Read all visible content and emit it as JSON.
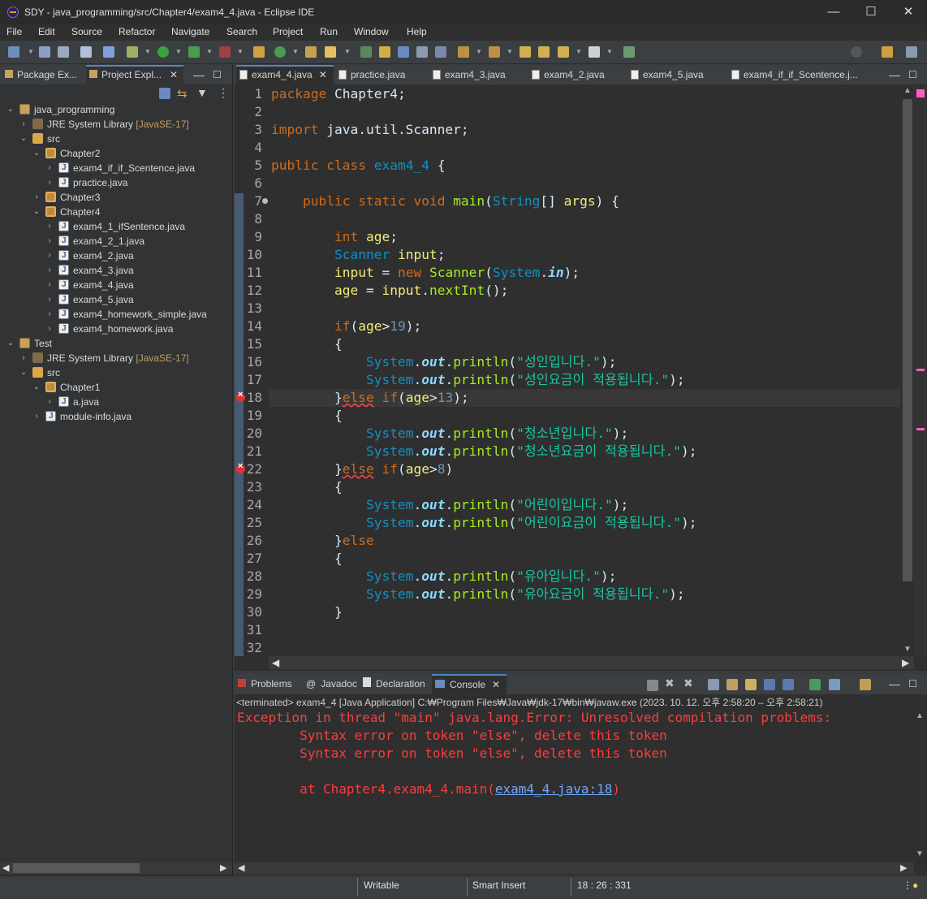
{
  "window": {
    "title": "SDY - java_programming/src/Chapter4/exam4_4.java - Eclipse IDE",
    "minimize": "—",
    "maximize": "☐",
    "close": "✕"
  },
  "menu": [
    "File",
    "Edit",
    "Source",
    "Refactor",
    "Navigate",
    "Search",
    "Project",
    "Run",
    "Window",
    "Help"
  ],
  "left_tabs": {
    "package_explorer": "Package Ex...",
    "project_explorer": "Project Expl..."
  },
  "tree": [
    {
      "label": "java_programming",
      "level": 0,
      "icon": "project",
      "expanded": true
    },
    {
      "label": "JRE System Library",
      "decor": "[JavaSE-17]",
      "level": 1,
      "icon": "library",
      "expanded": false
    },
    {
      "label": "src",
      "level": 1,
      "icon": "source-folder",
      "expanded": true
    },
    {
      "label": "Chapter2",
      "level": 2,
      "icon": "package",
      "expanded": true
    },
    {
      "label": "exam4_if_if_Scentence.java",
      "level": 3,
      "icon": "java-file",
      "expanded": false
    },
    {
      "label": "practice.java",
      "level": 3,
      "icon": "java-file",
      "expanded": false
    },
    {
      "label": "Chapter3",
      "level": 2,
      "icon": "package",
      "expanded": false
    },
    {
      "label": "Chapter4",
      "level": 2,
      "icon": "package",
      "expanded": true
    },
    {
      "label": "exam4_1_ifSentence.java",
      "level": 3,
      "icon": "java-file",
      "expanded": false
    },
    {
      "label": "exam4_2_1.java",
      "level": 3,
      "icon": "java-file",
      "expanded": false
    },
    {
      "label": "exam4_2.java",
      "level": 3,
      "icon": "java-file",
      "expanded": false
    },
    {
      "label": "exam4_3.java",
      "level": 3,
      "icon": "java-file",
      "expanded": false
    },
    {
      "label": "exam4_4.java",
      "level": 3,
      "icon": "java-file",
      "expanded": false
    },
    {
      "label": "exam4_5.java",
      "level": 3,
      "icon": "java-file",
      "expanded": false
    },
    {
      "label": "exam4_homework_simple.java",
      "level": 3,
      "icon": "java-file",
      "expanded": false
    },
    {
      "label": "exam4_homework.java",
      "level": 3,
      "icon": "java-file",
      "expanded": false
    },
    {
      "label": "Test",
      "level": 0,
      "icon": "project",
      "expanded": true
    },
    {
      "label": "JRE System Library",
      "decor": "[JavaSE-17]",
      "level": 1,
      "icon": "library",
      "expanded": false
    },
    {
      "label": "src",
      "level": 1,
      "icon": "source-folder",
      "expanded": true
    },
    {
      "label": "Chapter1",
      "level": 2,
      "icon": "package",
      "expanded": true
    },
    {
      "label": "a.java",
      "level": 3,
      "icon": "java-file",
      "expanded": false
    },
    {
      "label": "module-info.java",
      "level": 2,
      "icon": "java-file",
      "expanded": false
    }
  ],
  "editor_tabs": [
    "exam4_4.java",
    "practice.java",
    "exam4_3.java",
    "exam4_2.java",
    "exam4_5.java",
    "exam4_if_if_Scentence.j..."
  ],
  "code_lines": [
    {
      "n": "1",
      "t": [
        [
          "kw",
          "package"
        ],
        [
          "p",
          " Chapter4;"
        ]
      ]
    },
    {
      "n": "2",
      "t": []
    },
    {
      "n": "3",
      "t": [
        [
          "kw",
          "import"
        ],
        [
          "p",
          " java.util.Scanner;"
        ]
      ]
    },
    {
      "n": "4",
      "t": []
    },
    {
      "n": "5",
      "t": [
        [
          "kw",
          "public"
        ],
        [
          "p",
          " "
        ],
        [
          "kw",
          "class"
        ],
        [
          "p",
          " "
        ],
        [
          "cls",
          "exam4_4"
        ],
        [
          "p",
          " {"
        ]
      ]
    },
    {
      "n": "6",
      "t": []
    },
    {
      "n": "7",
      "t": [
        [
          "p",
          "    "
        ],
        [
          "kw",
          "public"
        ],
        [
          "p",
          " "
        ],
        [
          "kw",
          "static"
        ],
        [
          "p",
          " "
        ],
        [
          "kw",
          "void"
        ],
        [
          "p",
          " "
        ],
        [
          "fn",
          "main"
        ],
        [
          "p",
          "("
        ],
        [
          "cls",
          "String"
        ],
        [
          "p",
          "[] "
        ],
        [
          "vr",
          "args"
        ],
        [
          "p",
          ") {"
        ]
      ]
    },
    {
      "n": "8",
      "t": []
    },
    {
      "n": "9",
      "t": [
        [
          "p",
          "        "
        ],
        [
          "kw",
          "int"
        ],
        [
          "p",
          " "
        ],
        [
          "vr",
          "age"
        ],
        [
          "p",
          ";"
        ]
      ]
    },
    {
      "n": "10",
      "t": [
        [
          "p",
          "        "
        ],
        [
          "cls",
          "Scanner"
        ],
        [
          "p",
          " "
        ],
        [
          "vr",
          "input"
        ],
        [
          "p",
          ";"
        ]
      ]
    },
    {
      "n": "11",
      "t": [
        [
          "p",
          "        "
        ],
        [
          "vr",
          "input"
        ],
        [
          "p",
          " = "
        ],
        [
          "kw",
          "new"
        ],
        [
          "p",
          " "
        ],
        [
          "fn",
          "Scanner"
        ],
        [
          "p",
          "("
        ],
        [
          "cls",
          "System"
        ],
        [
          "p",
          "."
        ],
        [
          "fld",
          "in"
        ],
        [
          "p",
          ");"
        ]
      ]
    },
    {
      "n": "12",
      "t": [
        [
          "p",
          "        "
        ],
        [
          "vr",
          "age"
        ],
        [
          "p",
          " = "
        ],
        [
          "vr",
          "input"
        ],
        [
          "p",
          "."
        ],
        [
          "fn",
          "nextInt"
        ],
        [
          "p",
          "();"
        ]
      ]
    },
    {
      "n": "13",
      "t": []
    },
    {
      "n": "14",
      "t": [
        [
          "p",
          "        "
        ],
        [
          "kw",
          "if"
        ],
        [
          "p",
          "("
        ],
        [
          "vr",
          "age"
        ],
        [
          "p",
          ">"
        ],
        [
          "num",
          "19"
        ],
        [
          "p",
          ");"
        ]
      ]
    },
    {
      "n": "15",
      "t": [
        [
          "p",
          "        {"
        ]
      ]
    },
    {
      "n": "16",
      "t": [
        [
          "p",
          "            "
        ],
        [
          "cls",
          "System"
        ],
        [
          "p",
          "."
        ],
        [
          "fld",
          "out"
        ],
        [
          "p",
          "."
        ],
        [
          "fn",
          "println"
        ],
        [
          "p",
          "("
        ],
        [
          "str",
          "\"성인입니다.\""
        ],
        [
          "p",
          ");"
        ]
      ]
    },
    {
      "n": "17",
      "t": [
        [
          "p",
          "            "
        ],
        [
          "cls",
          "System"
        ],
        [
          "p",
          "."
        ],
        [
          "fld",
          "out"
        ],
        [
          "p",
          "."
        ],
        [
          "fn",
          "println"
        ],
        [
          "p",
          "("
        ],
        [
          "str",
          "\"성인요금이 적용됩니다.\""
        ],
        [
          "p",
          ");"
        ]
      ]
    },
    {
      "n": "18",
      "t": [
        [
          "p",
          "        }"
        ],
        [
          "kwe",
          "else"
        ],
        [
          "p",
          " "
        ],
        [
          "kw",
          "if"
        ],
        [
          "p",
          "("
        ],
        [
          "vr",
          "age"
        ],
        [
          "p",
          ">"
        ],
        [
          "num",
          "13"
        ],
        [
          "p",
          ");"
        ]
      ]
    },
    {
      "n": "19",
      "t": [
        [
          "p",
          "        {"
        ]
      ]
    },
    {
      "n": "20",
      "t": [
        [
          "p",
          "            "
        ],
        [
          "cls",
          "System"
        ],
        [
          "p",
          "."
        ],
        [
          "fld",
          "out"
        ],
        [
          "p",
          "."
        ],
        [
          "fn",
          "println"
        ],
        [
          "p",
          "("
        ],
        [
          "str",
          "\"청소년입니다.\""
        ],
        [
          "p",
          ");"
        ]
      ]
    },
    {
      "n": "21",
      "t": [
        [
          "p",
          "            "
        ],
        [
          "cls",
          "System"
        ],
        [
          "p",
          "."
        ],
        [
          "fld",
          "out"
        ],
        [
          "p",
          "."
        ],
        [
          "fn",
          "println"
        ],
        [
          "p",
          "("
        ],
        [
          "str",
          "\"청소년요금이 적용됩니다.\""
        ],
        [
          "p",
          ");"
        ]
      ]
    },
    {
      "n": "22",
      "t": [
        [
          "p",
          "        }"
        ],
        [
          "kwe",
          "else"
        ],
        [
          "p",
          " "
        ],
        [
          "kw",
          "if"
        ],
        [
          "p",
          "("
        ],
        [
          "vr",
          "age"
        ],
        [
          "p",
          ">"
        ],
        [
          "num",
          "8"
        ],
        [
          "p",
          ")"
        ]
      ]
    },
    {
      "n": "23",
      "t": [
        [
          "p",
          "        {"
        ]
      ]
    },
    {
      "n": "24",
      "t": [
        [
          "p",
          "            "
        ],
        [
          "cls",
          "System"
        ],
        [
          "p",
          "."
        ],
        [
          "fld",
          "out"
        ],
        [
          "p",
          "."
        ],
        [
          "fn",
          "println"
        ],
        [
          "p",
          "("
        ],
        [
          "str",
          "\"어린이입니다.\""
        ],
        [
          "p",
          ");"
        ]
      ]
    },
    {
      "n": "25",
      "t": [
        [
          "p",
          "            "
        ],
        [
          "cls",
          "System"
        ],
        [
          "p",
          "."
        ],
        [
          "fld",
          "out"
        ],
        [
          "p",
          "."
        ],
        [
          "fn",
          "println"
        ],
        [
          "p",
          "("
        ],
        [
          "str",
          "\"어린이요금이 적용됩니다.\""
        ],
        [
          "p",
          ");"
        ]
      ]
    },
    {
      "n": "26",
      "t": [
        [
          "p",
          "        }"
        ],
        [
          "kw",
          "else"
        ]
      ]
    },
    {
      "n": "27",
      "t": [
        [
          "p",
          "        {"
        ]
      ]
    },
    {
      "n": "28",
      "t": [
        [
          "p",
          "            "
        ],
        [
          "cls",
          "System"
        ],
        [
          "p",
          "."
        ],
        [
          "fld",
          "out"
        ],
        [
          "p",
          "."
        ],
        [
          "fn",
          "println"
        ],
        [
          "p",
          "("
        ],
        [
          "str",
          "\"유아입니다.\""
        ],
        [
          "p",
          ");"
        ]
      ]
    },
    {
      "n": "29",
      "t": [
        [
          "p",
          "            "
        ],
        [
          "cls",
          "System"
        ],
        [
          "p",
          "."
        ],
        [
          "fld",
          "out"
        ],
        [
          "p",
          "."
        ],
        [
          "fn",
          "println"
        ],
        [
          "p",
          "("
        ],
        [
          "str",
          "\"유아요금이 적용됩니다.\""
        ],
        [
          "p",
          ");"
        ]
      ]
    },
    {
      "n": "30",
      "t": [
        [
          "p",
          "        }"
        ]
      ]
    },
    {
      "n": "31",
      "t": []
    },
    {
      "n": "32",
      "t": []
    }
  ],
  "error_lines": [
    "18",
    "22"
  ],
  "bottom_tabs": {
    "problems": "Problems",
    "javadoc": "Javadoc",
    "declaration": "Declaration",
    "console": "Console"
  },
  "console": {
    "status": "<terminated> exam4_4 [Java Application] C:₩Program Files₩Java₩jdk-17₩bin₩javaw.exe  (2023. 10. 12. 오후 2:58:20 – 오후 2:58:21)",
    "lines": [
      "Exception in thread \"main\" java.lang.Error: Unresolved compilation problems: ",
      "\tSyntax error on token \"else\", delete this token",
      "\tSyntax error on token \"else\", delete this token",
      "",
      "\tat Chapter4.exam4_4.main("
    ],
    "link": "exam4_4.java:18",
    "link_suffix": ")"
  },
  "status": {
    "writable": "Writable",
    "insert_mode": "Smart Insert",
    "position": "18 : 26 : 331"
  },
  "colors": {
    "keyword": "#cc6c1d",
    "type": "#1290c3",
    "variable": "#f3ec79",
    "method": "#a7ec21",
    "string": "#17c6a3",
    "error": "#ff3c3c"
  }
}
